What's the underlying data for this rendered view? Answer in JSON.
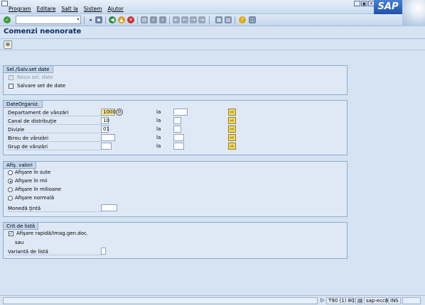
{
  "menu": {
    "items": [
      "Program",
      "Editare",
      "Salt la",
      "Sistem",
      "Ajutor"
    ]
  },
  "window_buttons": {
    "minimize": "_",
    "restore": "▣",
    "close": "✕"
  },
  "brand": {
    "logo": "SAP"
  },
  "toolbar": {
    "command_value": "",
    "icons": [
      "enter-icon",
      "save-icon",
      "back-icon",
      "exit-icon",
      "cancel-icon",
      "print-icon",
      "find-icon",
      "find-next-icon",
      "first-page-icon",
      "prev-page-icon",
      "next-page-icon",
      "last-page-icon",
      "new-session-icon",
      "shortcut-icon",
      "help-icon",
      "customize-icon"
    ]
  },
  "title": "Comenzi neonorate",
  "group_sel": {
    "title": "Sel./Salv.set date",
    "noua_sel_label": "Noua sel. date",
    "noua_sel_checked": true,
    "salvare_label": "Salvare set de date",
    "salvare_checked": false
  },
  "group_org": {
    "title": "DateOrganiz.",
    "la": "la",
    "rows": [
      {
        "label": "Departament de vânzări",
        "from": "1000"
      },
      {
        "label": "Canal de distribuţie",
        "from": "10"
      },
      {
        "label": "Divizie",
        "from": "01"
      },
      {
        "label": "Birou de vânzări",
        "from": ""
      },
      {
        "label": "Grup de vânzări",
        "from": ""
      }
    ]
  },
  "group_values": {
    "title": "Afiş. valori",
    "options": [
      {
        "label": "Afişare în sute",
        "selected": false
      },
      {
        "label": "Afişare în mii",
        "selected": true
      },
      {
        "label": "Afişare în milioane",
        "selected": false
      },
      {
        "label": "Afişare normală",
        "selected": false
      }
    ],
    "currency_label": "Monedă ţintă",
    "currency_value": ""
  },
  "group_list": {
    "title": "Crit.de listă",
    "quick_label": "Afişare rapidă/Imag.gen.doc.",
    "quick_checked": true,
    "or_text": "sau",
    "variant_label": "Variantă de listă",
    "variant_value": ""
  },
  "status": {
    "system": "T90 (1) 801",
    "server": "sap-ecc6",
    "mode": "INS"
  },
  "colors": {
    "background": "#d6e3f3",
    "title": "#0e2a6b",
    "required_field": "#ffe98a",
    "arrow_button": "#f3d65a"
  }
}
